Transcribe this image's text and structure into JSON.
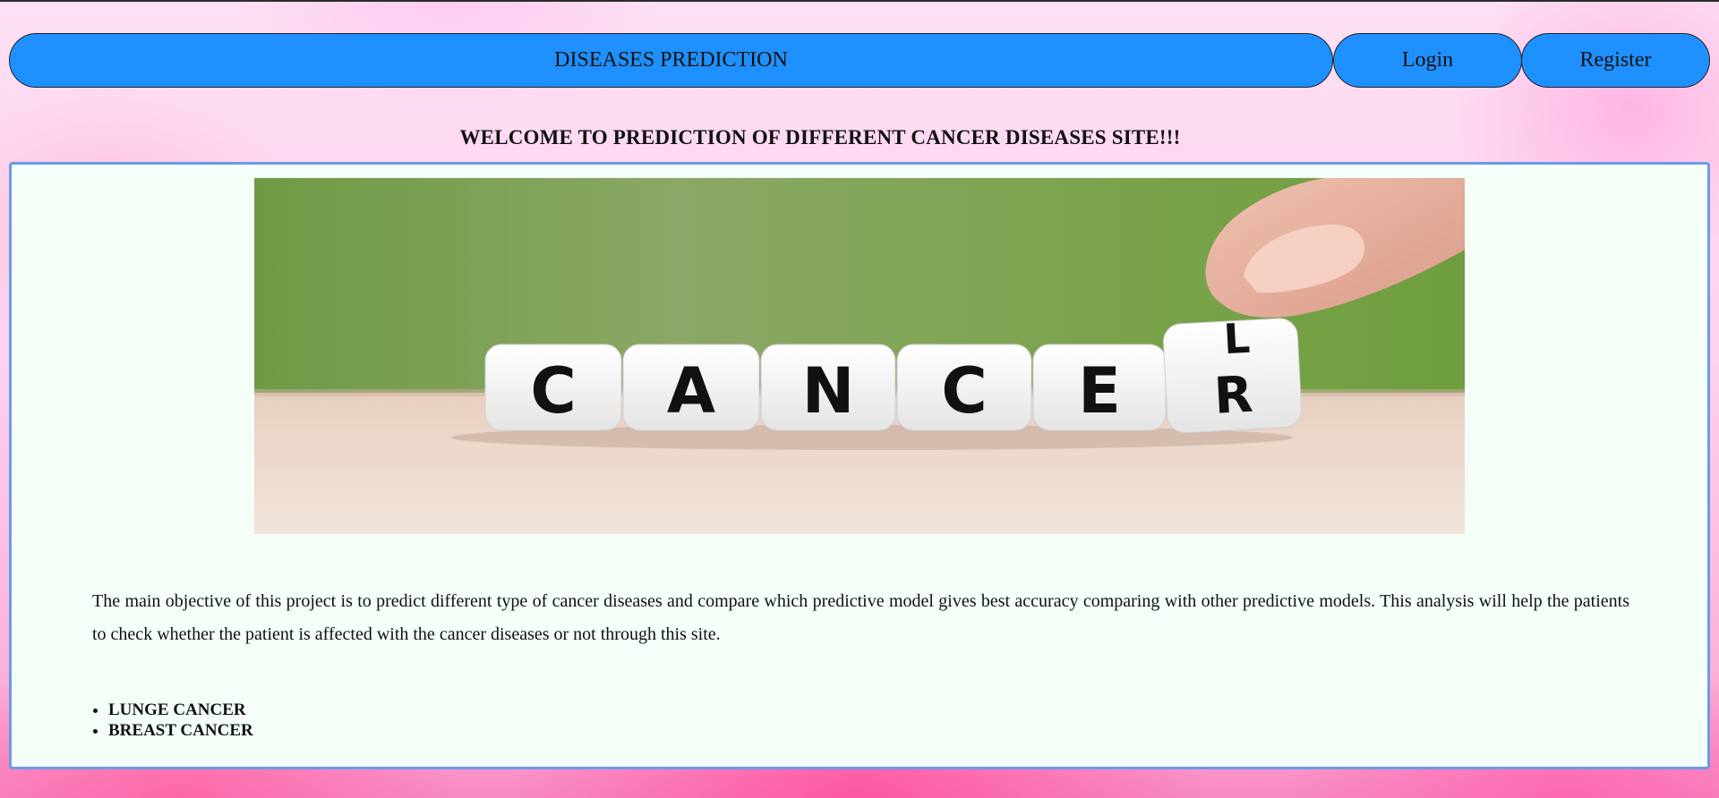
{
  "nav": {
    "title": "DISEASES PREDICTION",
    "login_label": "Login",
    "register_label": "Register",
    "accent_color": "#1e90ff"
  },
  "welcome": {
    "heading": "WELCOME TO PREDICTION OF DIFFERENT CANCER DISEASES SITE!!!"
  },
  "hero": {
    "image_semantic": "cancer-dice-image",
    "dice_letters": [
      "C",
      "A",
      "N",
      "C",
      "E",
      "R"
    ],
    "top_die_letter": "L"
  },
  "main": {
    "objective_text": "The main objective of this project is to predict different type of cancer diseases and compare which predictive model gives best accuracy comparing with other predictive models. This analysis will help the patients to check whether the patient is affected with the cancer diseases or not through this site.",
    "diseases": [
      "LUNGE CANCER",
      "BREAST CANCER"
    ]
  }
}
